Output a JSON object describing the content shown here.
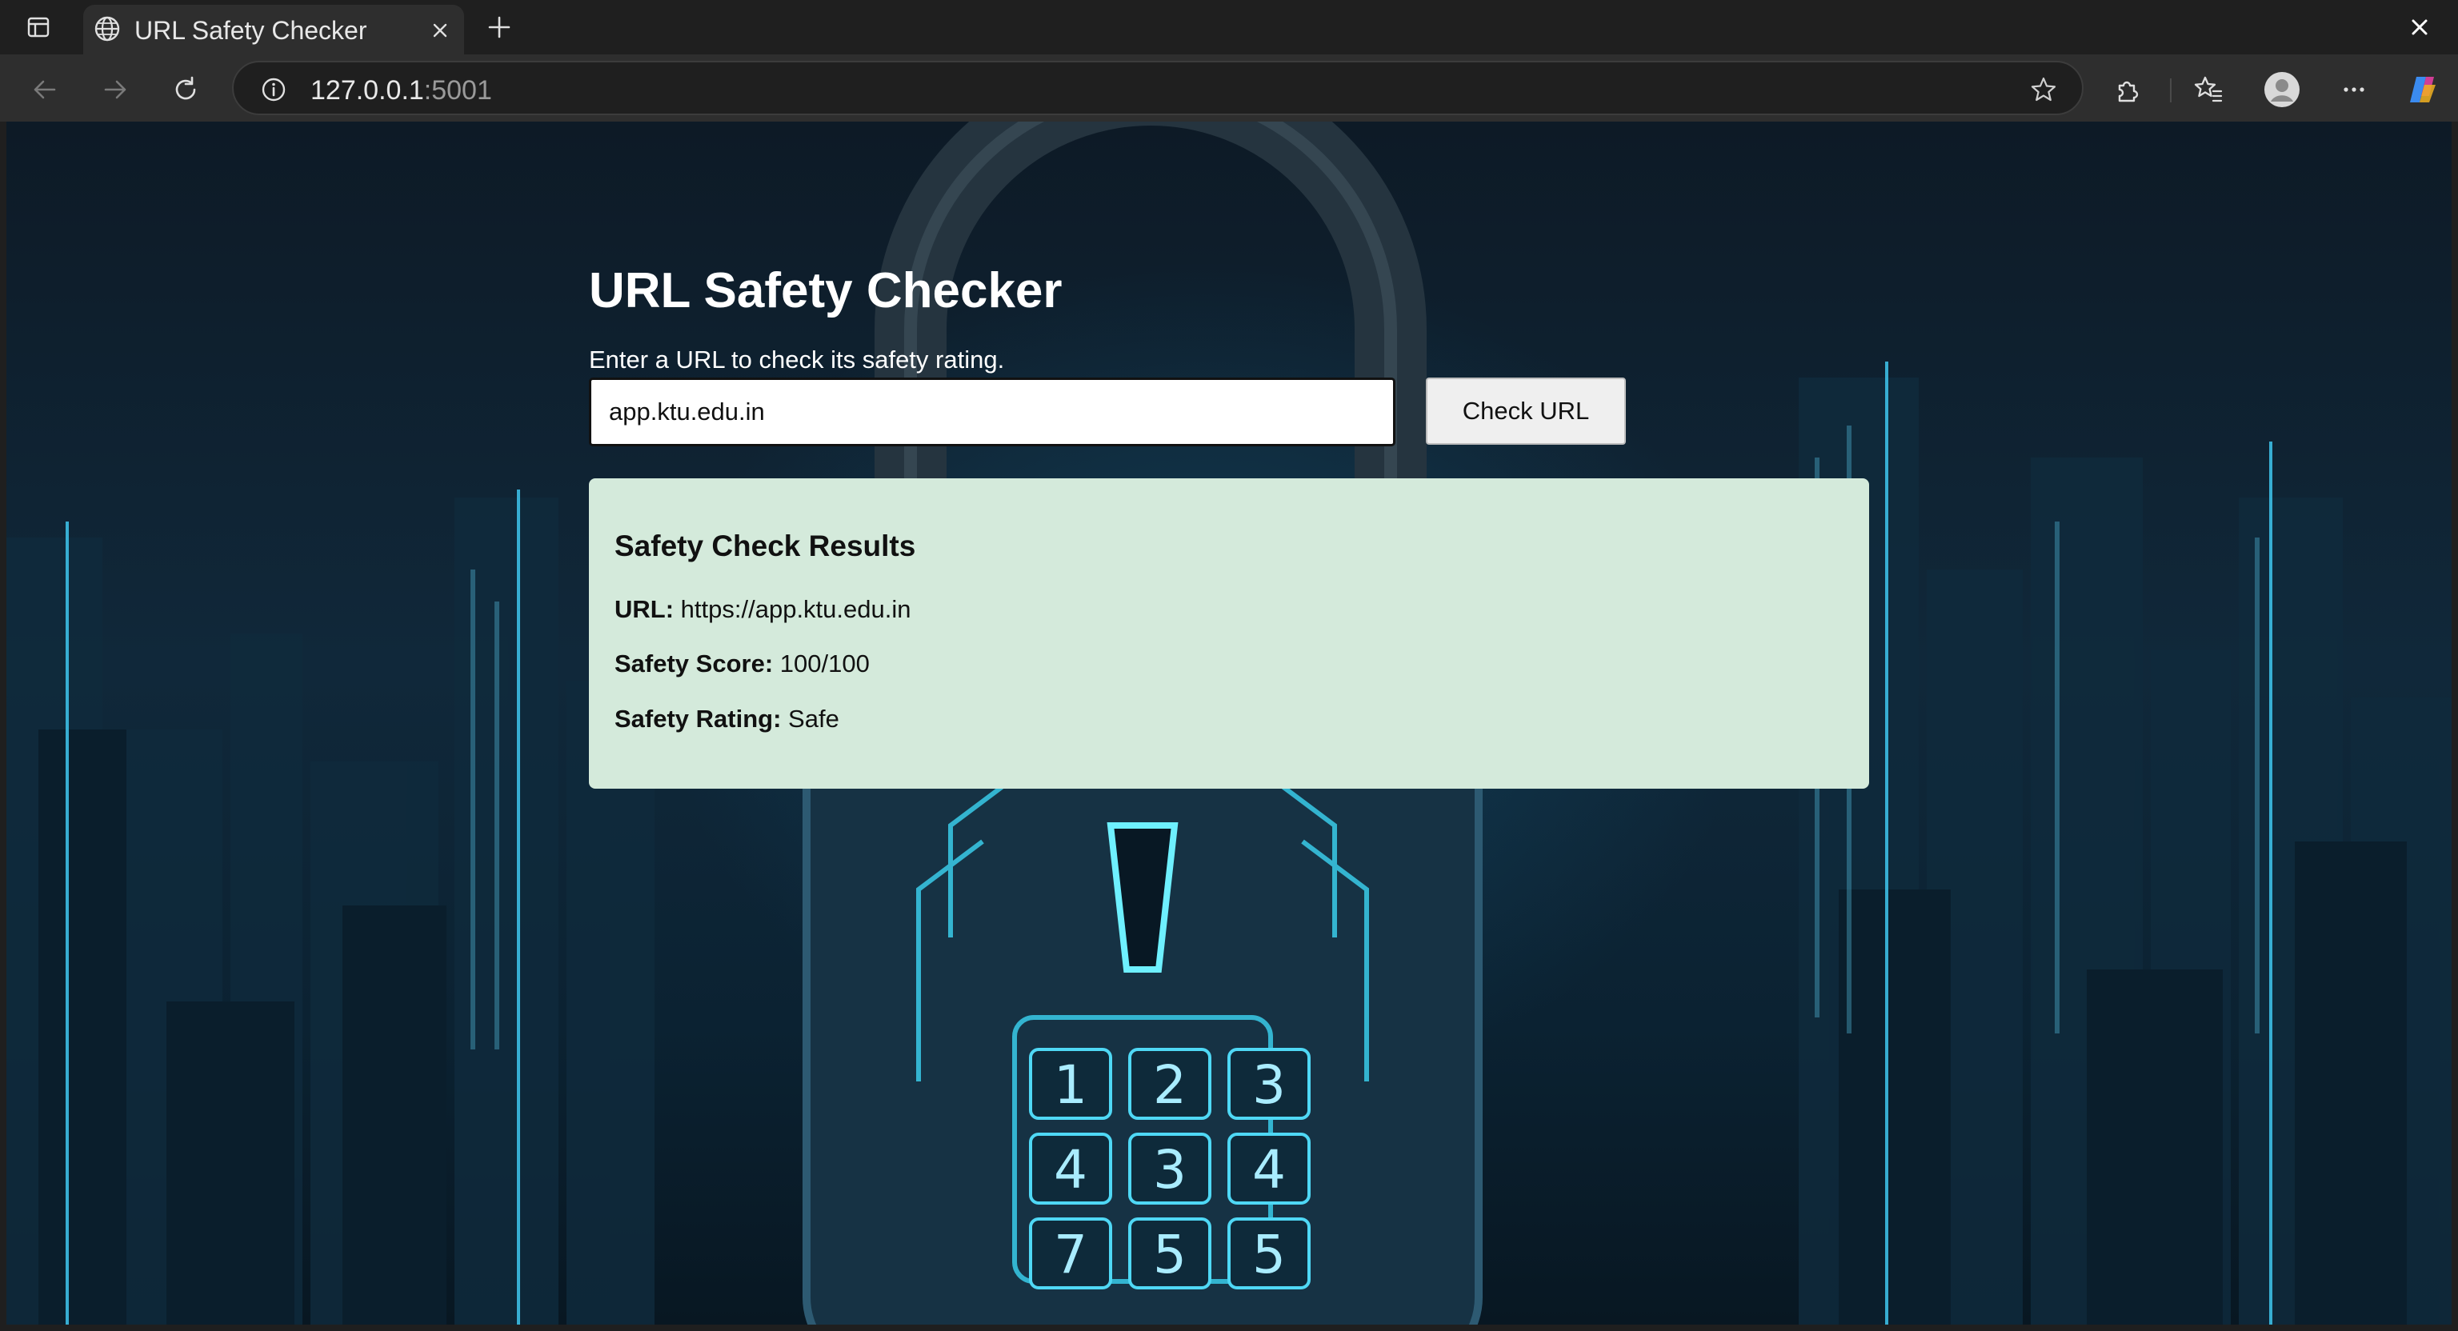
{
  "browser": {
    "tab_title": "URL Safety Checker",
    "url_host": "127.0.0.1",
    "url_port": ":5001"
  },
  "page": {
    "title": "URL Safety Checker",
    "subtitle": "Enter a URL to check its safety rating.",
    "input_value": "app.ktu.edu.in",
    "button_label": "Check URL"
  },
  "results": {
    "heading": "Safety Check Results",
    "url_label": "URL:",
    "url_value": "https://app.ktu.edu.in",
    "score_label": "Safety Score:",
    "score_value": "100/100",
    "rating_label": "Safety Rating:",
    "rating_value": "Safe"
  },
  "background": {
    "keypad_digits": [
      "1",
      "2",
      "3",
      "4",
      "3",
      "4",
      "7",
      "5",
      "5"
    ]
  },
  "colors": {
    "results_bg": "#d4eadb",
    "page_bg": "#0d1a26",
    "accent_glow": "#28bee6"
  }
}
